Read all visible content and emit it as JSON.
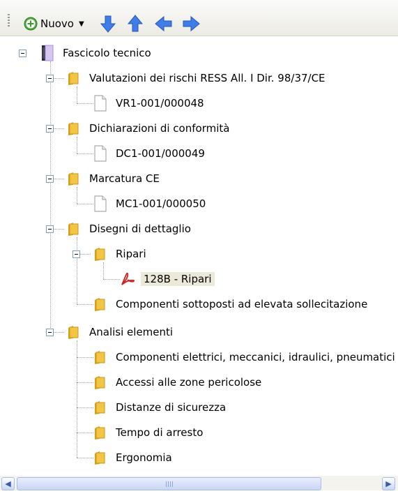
{
  "toolbar": {
    "new_label": "Nuovo",
    "icons": [
      "new-icon",
      "arrow-down-icon",
      "arrow-up-icon",
      "arrow-left-icon",
      "arrow-right-icon"
    ]
  },
  "tree": [
    {
      "label": "Fascicolo tecnico",
      "icon": "binder-icon"
    },
    {
      "label": "Valutazioni dei rischi RESS All. I Dir. 98/37/CE",
      "icon": "folder-icon"
    },
    {
      "label": "VR1-001/000048",
      "icon": "document-icon"
    },
    {
      "label": "Dichiarazioni di conformità",
      "icon": "folder-icon"
    },
    {
      "label": "DC1-001/000049",
      "icon": "document-icon"
    },
    {
      "label": "Marcatura CE",
      "icon": "folder-icon"
    },
    {
      "label": "MC1-001/000050",
      "icon": "document-icon"
    },
    {
      "label": "Disegni di dettaglio",
      "icon": "folder-icon"
    },
    {
      "label": "Ripari",
      "icon": "folder-icon"
    },
    {
      "label": "128B - Ripari",
      "icon": "pdf-icon",
      "selected": true
    },
    {
      "label": "Componenti sottoposti ad elevata sollecitazione",
      "icon": "folder-icon"
    },
    {
      "label": "Analisi elementi",
      "icon": "folder-icon"
    },
    {
      "label": "Componenti elettrici, meccanici, idraulici, pneumatici",
      "icon": "folder-icon"
    },
    {
      "label": "Accessi alle zone pericolose",
      "icon": "folder-icon"
    },
    {
      "label": "Distanze di sicurezza",
      "icon": "folder-icon"
    },
    {
      "label": "Tempo di arresto",
      "icon": "folder-icon"
    },
    {
      "label": "Ergonomia",
      "icon": "folder-icon"
    }
  ],
  "colors": {
    "selection": "#ece9d8",
    "folder": "#f3c544",
    "arrows": "#3f7ee8"
  }
}
